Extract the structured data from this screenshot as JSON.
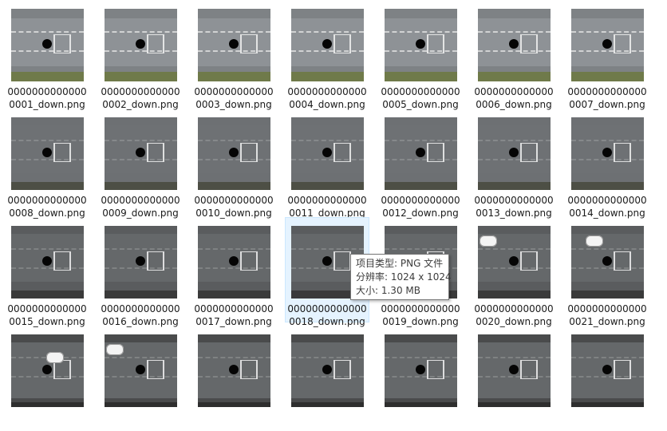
{
  "files": [
    {
      "name_line1": "0000000000000",
      "name_line2": "0001_down.png"
    },
    {
      "name_line1": "0000000000000",
      "name_line2": "0002_down.png"
    },
    {
      "name_line1": "0000000000000",
      "name_line2": "0003_down.png"
    },
    {
      "name_line1": "0000000000000",
      "name_line2": "0004_down.png"
    },
    {
      "name_line1": "0000000000000",
      "name_line2": "0005_down.png"
    },
    {
      "name_line1": "0000000000000",
      "name_line2": "0006_down.png"
    },
    {
      "name_line1": "0000000000000",
      "name_line2": "0007_down.png"
    },
    {
      "name_line1": "0000000000000",
      "name_line2": "0008_down.png"
    },
    {
      "name_line1": "0000000000000",
      "name_line2": "0009_down.png"
    },
    {
      "name_line1": "0000000000000",
      "name_line2": "0010_down.png"
    },
    {
      "name_line1": "0000000000000",
      "name_line2": "0011_down.png"
    },
    {
      "name_line1": "0000000000000",
      "name_line2": "0012_down.png"
    },
    {
      "name_line1": "0000000000000",
      "name_line2": "0013_down.png"
    },
    {
      "name_line1": "0000000000000",
      "name_line2": "0014_down.png"
    },
    {
      "name_line1": "0000000000000",
      "name_line2": "0015_down.png"
    },
    {
      "name_line1": "0000000000000",
      "name_line2": "0016_down.png"
    },
    {
      "name_line1": "0000000000000",
      "name_line2": "0017_down.png"
    },
    {
      "name_line1": "0000000000000",
      "name_line2": "0018_down.png"
    },
    {
      "name_line1": "0000000000000",
      "name_line2": "0019_down.png"
    },
    {
      "name_line1": "0000000000000",
      "name_line2": "0020_down.png"
    },
    {
      "name_line1": "0000000000000",
      "name_line2": "0021_down.png"
    },
    {
      "name_line1": "",
      "name_line2": ""
    },
    {
      "name_line1": "",
      "name_line2": ""
    },
    {
      "name_line1": "",
      "name_line2": ""
    },
    {
      "name_line1": "",
      "name_line2": ""
    },
    {
      "name_line1": "",
      "name_line2": ""
    },
    {
      "name_line1": "",
      "name_line2": ""
    },
    {
      "name_line1": "",
      "name_line2": ""
    }
  ],
  "hovered_file_index": 17,
  "tooltip": {
    "type_line": "项目类型: PNG 文件",
    "resolution_line": "分辨率: 1024 x 1024",
    "size_line": "大小: 1.30 MB"
  },
  "colors": {
    "hover_background": "#e5f3ff",
    "hover_border": "#cce8ff",
    "text": "#1a1a1a"
  }
}
